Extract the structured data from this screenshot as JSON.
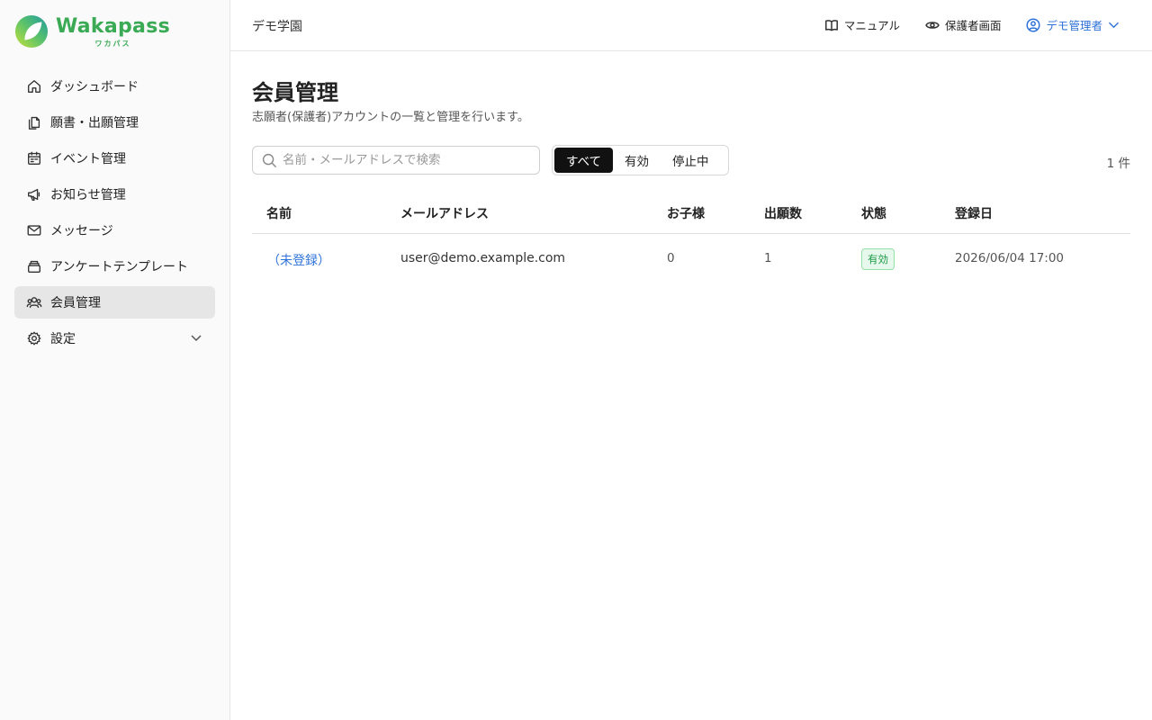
{
  "brand": {
    "name": "Wakapass",
    "kana": "ワカパス",
    "accent": "#3aaa55"
  },
  "sidebar": {
    "items": [
      {
        "label": "ダッシュボード",
        "icon": "home-icon"
      },
      {
        "label": "願書・出願管理",
        "icon": "documents-icon"
      },
      {
        "label": "イベント管理",
        "icon": "calendar-icon"
      },
      {
        "label": "お知らせ管理",
        "icon": "megaphone-icon"
      },
      {
        "label": "メッセージ",
        "icon": "mail-icon"
      },
      {
        "label": "アンケートテンプレート",
        "icon": "stack-icon"
      },
      {
        "label": "会員管理",
        "icon": "users-icon",
        "active": true
      },
      {
        "label": "設定",
        "icon": "gear-icon",
        "expandable": true
      }
    ]
  },
  "header": {
    "org_name": "デモ学園",
    "manual_label": "マニュアル",
    "guardian_view_label": "保護者画面",
    "user_label": "デモ管理者"
  },
  "main": {
    "title": "会員管理",
    "description": "志願者(保護者)アカウントの一覧と管理を行います。",
    "search": {
      "placeholder": "名前・メールアドレスで検索",
      "value": ""
    },
    "filters": [
      {
        "label": "すべて",
        "active": true
      },
      {
        "label": "有効",
        "active": false
      },
      {
        "label": "停止中",
        "active": false
      }
    ],
    "count_label": "1 件",
    "table": {
      "headers": [
        "名前",
        "メールアドレス",
        "お子様",
        "出願数",
        "状態",
        "登録日"
      ],
      "rows": [
        {
          "name": "（未登録）",
          "email": "user@demo.example.com",
          "children": "0",
          "applications": "1",
          "status": "有効",
          "registered": "2026/06/04 17:00"
        }
      ]
    }
  }
}
